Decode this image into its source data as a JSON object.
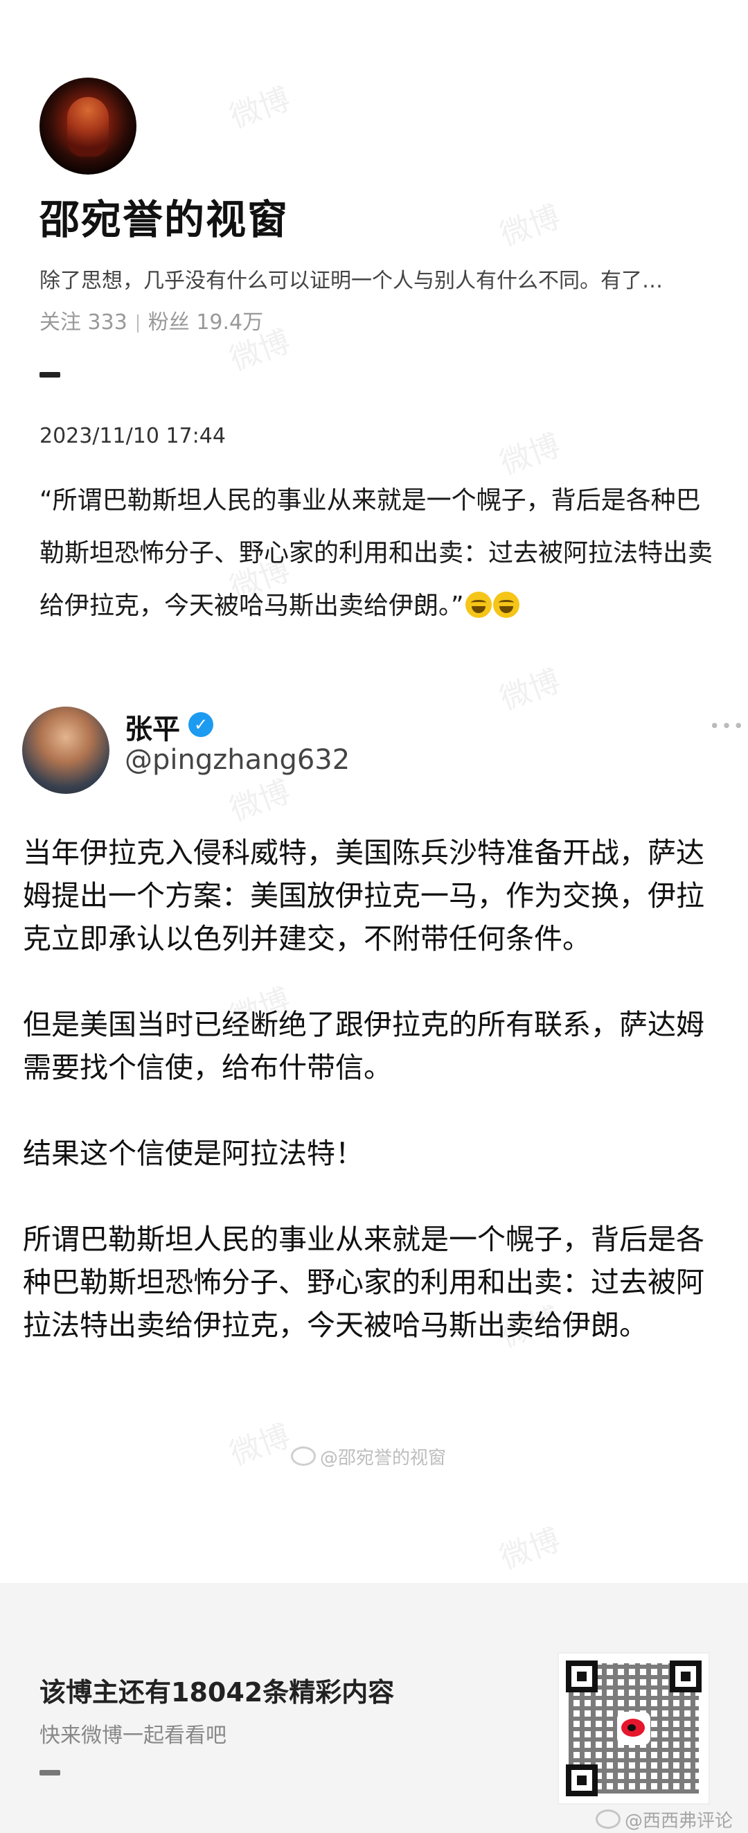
{
  "profile": {
    "name": "邵宛誉的视窗",
    "bio": "除了思想，几乎没有什么可以证明一个人与别人有什么不同。有了…",
    "follow_label": "关注 333",
    "fans_label": "粉丝 19.4万"
  },
  "post": {
    "datetime": "2023/11/10 17:44",
    "text": "“所谓巴勒斯坦人民的事业从来就是一个幌子，背后是各种巴勒斯坦恐怖分子、野心家的利用和出卖：过去被阿拉法特出卖给伊拉克，今天被哈马斯出卖给伊朗。”"
  },
  "tweet": {
    "name": "张平",
    "handle": "@pingzhang632",
    "more": "•••",
    "paragraphs": [
      "当年伊拉克入侵科威特，美国陈兵沙特准备开战，萨达姆提出一个方案：美国放伊拉克一马，作为交换，伊拉克立即承认以色列并建交，不附带任何条件。",
      "但是美国当时已经断绝了跟伊拉克的所有联系，萨达姆需要找个信使，给布什带信。",
      "结果这个信使是阿拉法特！",
      "所谓巴勒斯坦人民的事业从来就是一个幌子，背后是各种巴勒斯坦恐怖分子、野心家的利用和出卖：过去被阿拉法特出卖给伊拉克，今天被哈马斯出卖给伊朗。"
    ],
    "watermark_credit": "@邵宛誉的视窗"
  },
  "footer": {
    "title": "该博主还有18042条精彩内容",
    "subtitle": "快来微博一起看看吧",
    "credit": "@西西弗评论"
  },
  "watermark_text": "微博",
  "colors": {
    "verified": "#1d9bf0",
    "weibo_red": "#e6162d"
  }
}
